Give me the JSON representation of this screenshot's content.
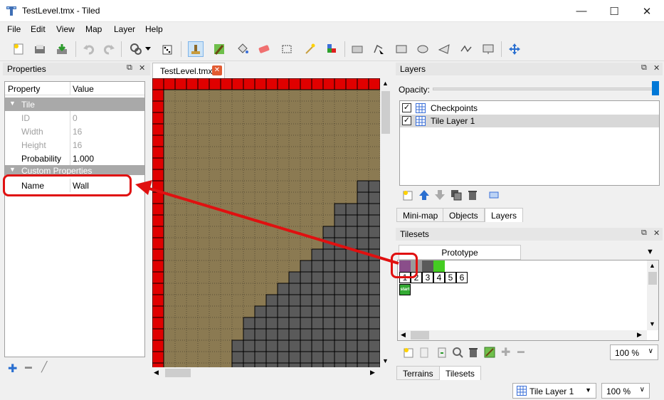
{
  "window": {
    "title": "TestLevel.tmx - Tiled",
    "minimize": "—",
    "maximize": "☐",
    "close": "✕"
  },
  "menu": [
    "File",
    "Edit",
    "View",
    "Map",
    "Layer",
    "Help"
  ],
  "toolbar": {
    "icons": [
      "new-file-icon",
      "open-file-icon",
      "save-file-icon",
      "undo-icon",
      "redo-icon",
      "commands-icon",
      "random-mode-icon",
      "stamp-brush-icon",
      "terrain-brush-icon",
      "bucket-fill-icon",
      "eraser-icon",
      "rect-select-icon",
      "magic-wand-icon",
      "select-same-tile-icon",
      "select-objects-icon",
      "edit-polygons-icon",
      "insert-rectangle-icon",
      "insert-ellipse-icon",
      "insert-polygon-icon",
      "insert-polyline-icon",
      "insert-tile-icon",
      "move-icon"
    ]
  },
  "properties": {
    "panel_title": "Properties",
    "col_property": "Property",
    "col_value": "Value",
    "group_tile": "Tile",
    "rows": [
      {
        "key": "ID",
        "value": "0"
      },
      {
        "key": "Width",
        "value": "16"
      },
      {
        "key": "Height",
        "value": "16"
      },
      {
        "key": "Probability",
        "value": "1.000"
      }
    ],
    "group_custom": "Custom Properties",
    "custom_name_key": "Name",
    "custom_name_value": "Wall"
  },
  "map": {
    "tab_label": "TestLevel.tmx",
    "colors": {
      "ground": "#8b7a52",
      "wall": "#e00000",
      "block": "#5a5a5a"
    }
  },
  "layers": {
    "panel_title": "Layers",
    "opacity_label": "Opacity:",
    "items": [
      {
        "name": "Checkpoints",
        "checked": "✓"
      },
      {
        "name": "Tile Layer 1",
        "checked": "✓"
      }
    ],
    "tabs": [
      "Mini-map",
      "Objects",
      "Layers"
    ]
  },
  "tilesets": {
    "panel_title": "Tilesets",
    "tab_label": "Prototype",
    "tile_numbers": [
      "1",
      "2",
      "3",
      "4",
      "5",
      "6"
    ],
    "start_tile": "start",
    "zoom": "100 %",
    "tabs": [
      "Terrains",
      "Tilesets"
    ]
  },
  "statusbar": {
    "layer_combo": "Tile Layer 1",
    "zoom": "100 %"
  },
  "accent": "#e01010"
}
